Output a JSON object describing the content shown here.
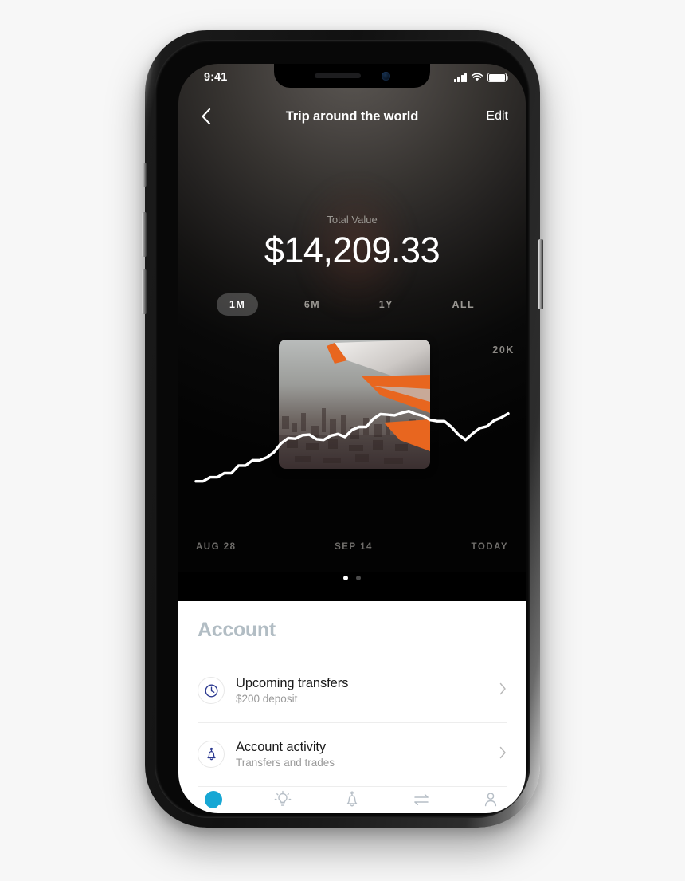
{
  "device": {
    "name": "smartphone-mockup",
    "status_bar": {
      "time": "9:41",
      "signal_icon": "cellular-signal-icon",
      "wifi_icon": "wifi-icon",
      "battery_icon": "battery-full-icon"
    }
  },
  "nav": {
    "back_icon": "chevron-left-icon",
    "title": "Trip around the world",
    "edit_label": "Edit"
  },
  "summary": {
    "label": "Total Value",
    "amount": "$14,209.33"
  },
  "ranges": [
    {
      "label": "1M",
      "active": true
    },
    {
      "label": "6M",
      "active": false
    },
    {
      "label": "1Y",
      "active": false
    },
    {
      "label": "ALL",
      "active": false
    }
  ],
  "chart_data": {
    "type": "line",
    "title": "Total Value",
    "ylabel": "",
    "xlabel": "",
    "axis_label_right": "20K",
    "grid": false,
    "legend": false,
    "line_color": "#ffffff",
    "x_tick_labels": [
      "AUG 28",
      "SEP 14",
      "TODAY"
    ],
    "ylim": [
      9000,
      21000
    ],
    "x": [
      0,
      1,
      2,
      3,
      4,
      5,
      6,
      7,
      8,
      9,
      10,
      11,
      12,
      13,
      14,
      15,
      16,
      17,
      18,
      19,
      20,
      21,
      22,
      23,
      24,
      25,
      26,
      27,
      28,
      29,
      30,
      31,
      32,
      33,
      34,
      35,
      36,
      37,
      38,
      39,
      40,
      41,
      42,
      43,
      44
    ],
    "values": [
      9700,
      9700,
      10050,
      10050,
      10400,
      10400,
      11050,
      11050,
      11500,
      11500,
      11750,
      12200,
      12950,
      13400,
      13350,
      13650,
      13700,
      13300,
      13250,
      13600,
      13750,
      13500,
      14100,
      14350,
      14350,
      15050,
      15450,
      15400,
      15350,
      15550,
      15700,
      15450,
      15300,
      14950,
      14850,
      14850,
      14350,
      13700,
      13250,
      13800,
      14250,
      14400,
      14900,
      15150,
      15500
    ]
  },
  "thumbnail": {
    "name": "airplane-wing-aerial-photo",
    "description": "Aerial view of a city from an airplane window with an orange-tipped wing"
  },
  "pagination": {
    "dots": [
      {
        "active": true
      },
      {
        "active": false
      }
    ]
  },
  "sheet": {
    "title": "Account",
    "rows": [
      {
        "icon": "clock-icon",
        "title": "Upcoming transfers",
        "subtitle": "$200 deposit",
        "chevron": "chevron-right-icon"
      },
      {
        "icon": "bell-icon",
        "title": "Account activity",
        "subtitle": "Transfers and trades",
        "chevron": "chevron-right-icon"
      }
    ]
  },
  "tab_bar": {
    "items": [
      {
        "icon": "app-logo-icon",
        "active": true
      },
      {
        "icon": "lightbulb-icon",
        "active": false
      },
      {
        "icon": "bell-icon",
        "active": false
      },
      {
        "icon": "transfer-arrows-icon",
        "active": false
      },
      {
        "icon": "person-icon",
        "active": false
      }
    ]
  },
  "colors": {
    "accent": "#17a7d4",
    "icon_navy": "#2b3990",
    "sheet_title": "#b2bdc4",
    "chart_line": "#ffffff",
    "muted_text": "#9a9a9a"
  }
}
